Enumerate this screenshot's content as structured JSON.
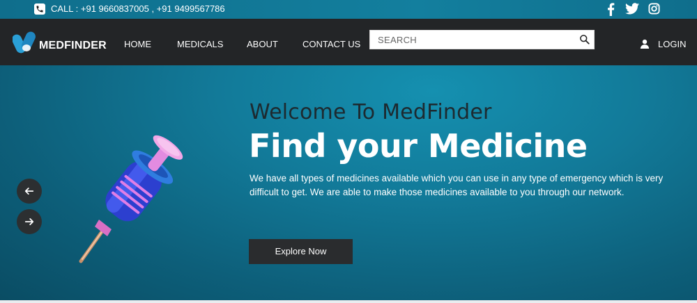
{
  "topbar": {
    "call_text": "CALL : +91 9660837005 , +91 9499567786",
    "phone_icon": "phone-icon",
    "social": [
      "facebook-icon",
      "twitter-icon",
      "instagram-icon"
    ]
  },
  "navbar": {
    "brand": "MEDFINDER",
    "links": [
      "HOME",
      "MEDICALS",
      "ABOUT",
      "CONTACT US"
    ],
    "search_placeholder": "SEARCH",
    "login": "LOGIN"
  },
  "hero": {
    "welcome": "Welcome To MedFinder",
    "headline": "Find your Medicine",
    "description": "We have all types of medicines available which you can use in any type of emergency which is very difficult to get. We are able to make those medicines available to you through our network.",
    "button": "Explore Now"
  },
  "colors": {
    "navbar_bg": "#232527",
    "hero_bg": "#127a99",
    "button_bg": "#2a2c2e",
    "logo_blue": "#2a9fd6"
  }
}
